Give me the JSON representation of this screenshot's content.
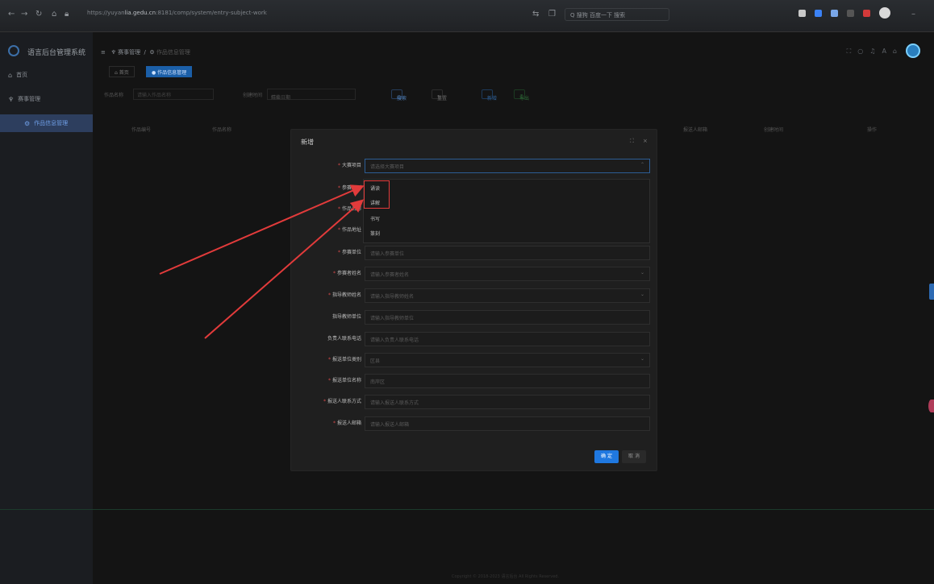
{
  "browser": {
    "url_prefix": "https://yuyan",
    "url_host": "lia.gedu.cn",
    "url_path": ":8181/comp/system/entry-subject-work",
    "search_text": "Q 搜狗 百度一下 搜索"
  },
  "sidebar": {
    "app_title": "语言后台管理系统",
    "items": [
      {
        "label": "首页",
        "icon": "home-icon"
      },
      {
        "label": "赛事管理",
        "icon": "trophy-icon"
      },
      {
        "label": "作品信息管理",
        "icon": "settings-icon"
      }
    ]
  },
  "header": {
    "breadcrumb_root": "赛事管理",
    "breadcrumb_current": "作品信息管理"
  },
  "tabs": [
    {
      "label": "首页"
    },
    {
      "label": "作品信息管理"
    }
  ],
  "filters": {
    "work_name_label": "作品名称",
    "work_name_placeholder": "请输入作品名称",
    "create_time_label": "创建时间",
    "start_date_placeholder": "开始日期",
    "end_date_placeholder": "结束日期",
    "search_label": "搜索",
    "reset_label": "重置",
    "add_label": "新增",
    "export_label": "导出"
  },
  "table": {
    "columns": [
      "作品编号",
      "作品名称",
      "报送人邮箱",
      "创建时间",
      "操作"
    ]
  },
  "modal": {
    "title": "新增",
    "fields": [
      {
        "label": "大赛项目",
        "required": true,
        "placeholder": "请选择大赛项目",
        "type": "select"
      },
      {
        "label": "参赛组别",
        "required": true,
        "placeholder": "",
        "type": "select"
      },
      {
        "label": "作品名称",
        "required": true,
        "placeholder": "",
        "type": "input"
      },
      {
        "label": "作品地址",
        "required": true,
        "placeholder": "",
        "type": "input"
      },
      {
        "label": "参赛单位",
        "required": true,
        "placeholder": "请输入参赛单位",
        "type": "input"
      },
      {
        "label": "参赛者姓名",
        "required": true,
        "placeholder": "请输入参赛者姓名",
        "type": "select"
      },
      {
        "label": "指导教师姓名",
        "required": true,
        "placeholder": "请输入指导教师姓名",
        "type": "select"
      },
      {
        "label": "指导教师单位",
        "required": false,
        "placeholder": "请输入指导教师单位",
        "type": "input"
      },
      {
        "label": "负责人联系电话",
        "required": false,
        "placeholder": "请输入负责人联系电话",
        "type": "input"
      },
      {
        "label": "报送单位类别",
        "required": true,
        "placeholder": "区县",
        "type": "select"
      },
      {
        "label": "报送单位名称",
        "required": true,
        "placeholder": "南岸区",
        "type": "input"
      },
      {
        "label": "报送人联系方式",
        "required": true,
        "placeholder": "请输入报送人联系方式",
        "type": "input"
      },
      {
        "label": "报送人邮箱",
        "required": true,
        "placeholder": "请输入报送人邮箱",
        "type": "input"
      }
    ],
    "dropdown_options": [
      "诵读",
      "讲解",
      "书写",
      "篆刻"
    ],
    "confirm_label": "确 定",
    "cancel_label": "取 消"
  },
  "footer": {
    "copyright": "Copyright © 2018-2023 语言后台 All Rights Reserved."
  },
  "colors": {
    "accent": "#1f78e0",
    "annotation": "#e23b3b",
    "background": "#141414"
  }
}
